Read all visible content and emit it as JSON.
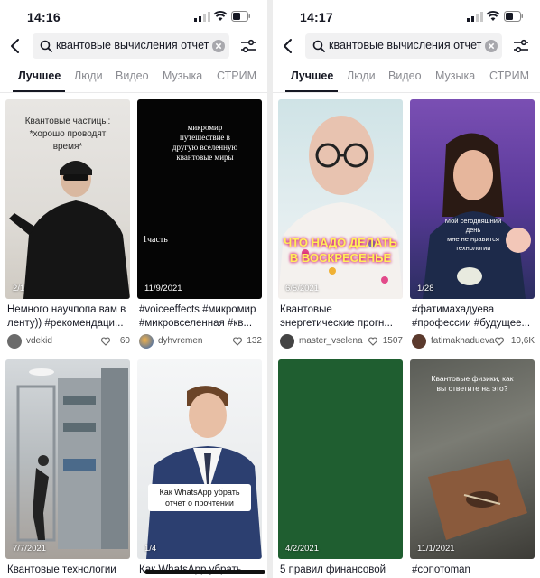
{
  "left": {
    "status": {
      "time": "14:16"
    },
    "search": {
      "query": "квантовые вычисления отчет"
    },
    "tabs": [
      "Лучшее",
      "Люди",
      "Видео",
      "Музыка",
      "СТРИМ"
    ],
    "cards": [
      {
        "overlay": "Квантовые частицы:\n*хорошо проводят\nвремя*",
        "label": "2/1",
        "caption": "Немного научпопа вам в ленту)) #рекомендаци...",
        "user": "vdekid",
        "likes": "60"
      },
      {
        "overlay": "микромир\nпутешествие в\nдругую вселенную\nквантовые миры",
        "overlay2": "1часть",
        "label": "11/9/2021",
        "caption": "#voiceeffects #микромир #микровселенная #кв...",
        "user": "dyhvremen",
        "likes": "132"
      },
      {
        "label": "7/7/2021",
        "caption": "Квантовые технологии"
      },
      {
        "overlay": "Как WhatsApp убрать\nотчет о прочтении",
        "label": "1/4",
        "caption": "Как WhatsApp убрать"
      }
    ]
  },
  "right": {
    "status": {
      "time": "14:17"
    },
    "search": {
      "query": "квантовые вычисления отчет"
    },
    "tabs": [
      "Лучшее",
      "Люди",
      "Видео",
      "Музыка",
      "СТРИМ"
    ],
    "cards": [
      {
        "overlay": "ЧТО НАДО ДЕЛАТЬ\nВ ВОСКРЕСЕНЬЕ",
        "label": "6/5/2021",
        "caption": "Квантовые энергетические прогн...",
        "user": "master_vselena",
        "likes": "1507"
      },
      {
        "overlay": "Мой сегодняшний день\nмне не нравится\nтехнологии",
        "label": "1/28",
        "caption": "#фатимахадуева #профессии #будущее...",
        "user": "fatimakhadueva",
        "likes": "10,6K"
      },
      {
        "label": "4/2/2021",
        "caption": "5 правил финансовой"
      },
      {
        "overlay": "Квантовые физики, как\nвы ответите на это?",
        "label": "11/1/2021",
        "caption": "#сопотоman"
      }
    ]
  },
  "colors": {
    "accent": "#161823",
    "muted": "#8a8b91",
    "bg": "#ffffff",
    "green_card": "#1f5e30"
  },
  "icons": [
    "back-icon",
    "search-icon",
    "clear-icon",
    "filter-icon",
    "heart-icon",
    "signal-icon",
    "wifi-icon",
    "battery-icon"
  ]
}
